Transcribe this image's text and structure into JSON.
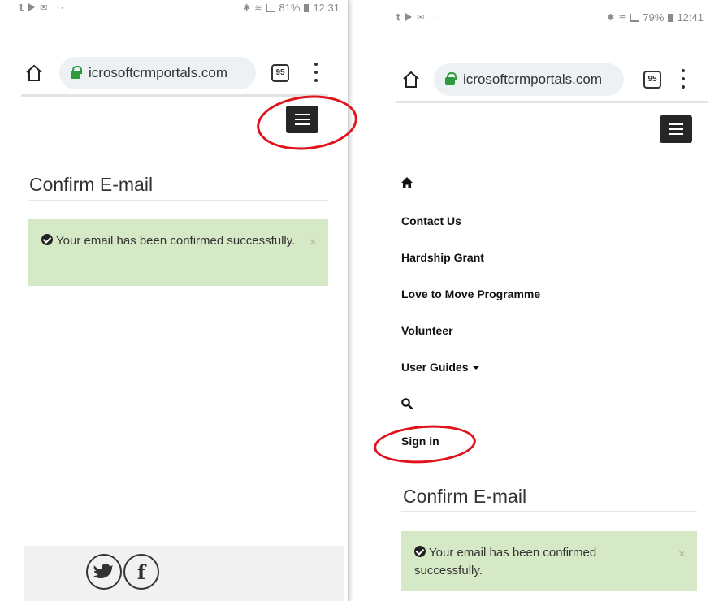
{
  "left_phone": {
    "status": {
      "left_icons": [
        "twitter-icon",
        "play-icon",
        "mail-icon"
      ],
      "more": "···",
      "right_text": "81%",
      "time": "12:31"
    },
    "url": "icrosoftcrmportals.com",
    "tab_count": "95",
    "page_title": "Confirm E-mail",
    "alert_text": "Your email has been confirmed successfully.",
    "alert_close": "×",
    "footer_icons": [
      "twitter-icon",
      "facebook-icon"
    ]
  },
  "right_phone": {
    "status": {
      "more": "···",
      "right_text": "79%",
      "time": "12:41"
    },
    "url": "icrosoftcrmportals.com",
    "tab_count": "95",
    "nav": {
      "home_icon": "home-icon",
      "items": [
        "Contact Us",
        "Hardship Grant",
        "Love to Move Programme",
        "Volunteer",
        "User Guides"
      ],
      "search_icon": "search-icon",
      "sign_in": "Sign in"
    },
    "page_title": "Confirm E-mail",
    "alert_text": "Your email has been confirmed successfully.",
    "alert_close": "×"
  },
  "colors": {
    "alert_bg": "#d6e9c6",
    "annotation": "#e0121c",
    "lock": "#2e9a3e",
    "hamburger": "#262626"
  }
}
